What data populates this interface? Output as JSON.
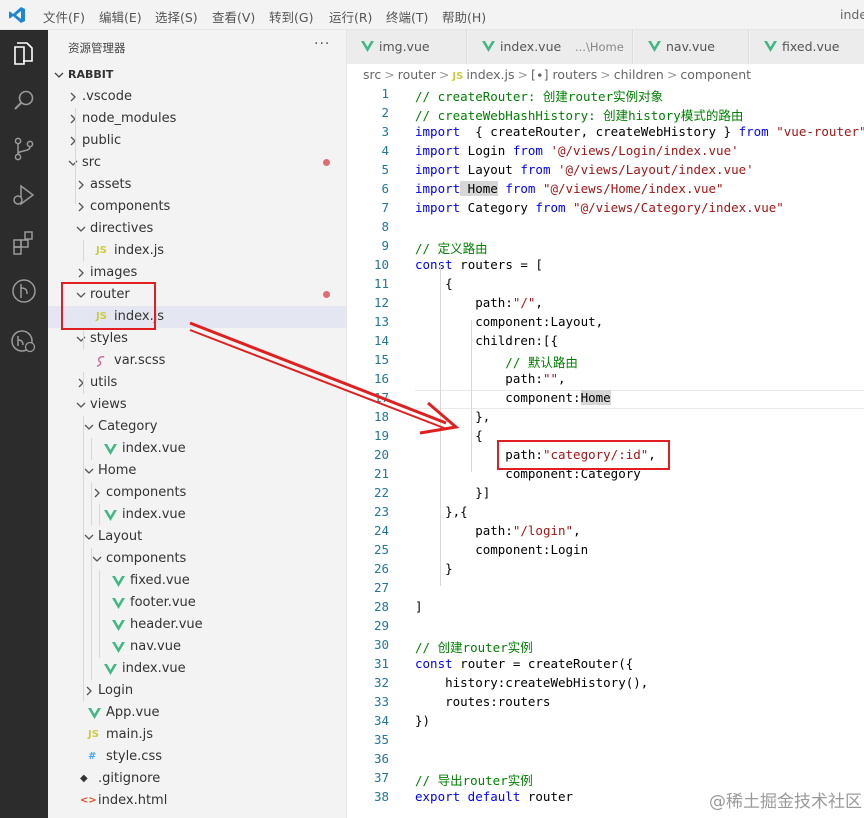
{
  "menubar": {
    "items": [
      "文件(F)",
      "编辑(E)",
      "选择(S)",
      "查看(V)",
      "转到(G)",
      "运行(R)",
      "终端(T)",
      "帮助(H)"
    ],
    "window_title": "inde"
  },
  "activity": {
    "icons": [
      "explorer-icon",
      "search-icon",
      "source-control-icon",
      "run-debug-icon",
      "extensions-icon",
      "git-graph-icon",
      "remote-icon"
    ]
  },
  "sidebar": {
    "title": "资源管理器",
    "more": "···",
    "root": "RABBIT",
    "items": [
      {
        "label": ".vscode",
        "kind": "folder",
        "open": false,
        "depth": 1
      },
      {
        "label": "node_modules",
        "kind": "folder",
        "open": false,
        "depth": 1
      },
      {
        "label": "public",
        "kind": "folder",
        "open": false,
        "depth": 1
      },
      {
        "label": "src",
        "kind": "folder",
        "open": true,
        "depth": 1,
        "modified": true
      },
      {
        "label": "assets",
        "kind": "folder",
        "open": false,
        "depth": 2
      },
      {
        "label": "components",
        "kind": "folder",
        "open": false,
        "depth": 2
      },
      {
        "label": "directives",
        "kind": "folder",
        "open": true,
        "depth": 2
      },
      {
        "label": "index.js",
        "kind": "js",
        "depth": 3
      },
      {
        "label": "images",
        "kind": "folder",
        "open": false,
        "depth": 2
      },
      {
        "label": "router",
        "kind": "folder",
        "open": true,
        "depth": 2,
        "modified": true
      },
      {
        "label": "index.js",
        "kind": "js",
        "depth": 3,
        "selected": true
      },
      {
        "label": "styles",
        "kind": "folder",
        "open": true,
        "depth": 2
      },
      {
        "label": "var.scss",
        "kind": "scss",
        "depth": 3
      },
      {
        "label": "utils",
        "kind": "folder",
        "open": false,
        "depth": 2
      },
      {
        "label": "views",
        "kind": "folder",
        "open": true,
        "depth": 2
      },
      {
        "label": "Category",
        "kind": "folder",
        "open": true,
        "depth": 3
      },
      {
        "label": "index.vue",
        "kind": "vue",
        "depth": 4
      },
      {
        "label": "Home",
        "kind": "folder",
        "open": true,
        "depth": 3
      },
      {
        "label": "components",
        "kind": "folder",
        "open": false,
        "depth": 4
      },
      {
        "label": "index.vue",
        "kind": "vue",
        "depth": 4
      },
      {
        "label": "Layout",
        "kind": "folder",
        "open": true,
        "depth": 3
      },
      {
        "label": "components",
        "kind": "folder",
        "open": true,
        "depth": 4
      },
      {
        "label": "fixed.vue",
        "kind": "vue",
        "depth": 5
      },
      {
        "label": "footer.vue",
        "kind": "vue",
        "depth": 5
      },
      {
        "label": "header.vue",
        "kind": "vue",
        "depth": 5
      },
      {
        "label": "nav.vue",
        "kind": "vue",
        "depth": 5
      },
      {
        "label": "index.vue",
        "kind": "vue",
        "depth": 4
      },
      {
        "label": "Login",
        "kind": "folder",
        "open": false,
        "depth": 3
      },
      {
        "label": "App.vue",
        "kind": "vue",
        "depth": 2
      },
      {
        "label": "main.js",
        "kind": "js",
        "depth": 2
      },
      {
        "label": "style.css",
        "kind": "css",
        "depth": 2
      },
      {
        "label": ".gitignore",
        "kind": "git",
        "depth": 1
      },
      {
        "label": "index.html",
        "kind": "html",
        "depth": 1
      }
    ]
  },
  "editor": {
    "tabs": [
      {
        "label": "img.vue",
        "detail": ""
      },
      {
        "label": "index.vue",
        "detail": "...\\Home"
      },
      {
        "label": "nav.vue",
        "detail": ""
      },
      {
        "label": "fixed.vue",
        "detail": ""
      }
    ],
    "breadcrumb": [
      "src",
      ">",
      "router",
      ">",
      "JS",
      "index.js",
      ">",
      "[∙] routers",
      ">",
      "children",
      ">",
      "component"
    ],
    "lines": [
      [
        [
          "cm",
          "// createRouter: 创建router实例对象"
        ]
      ],
      [
        [
          "cm",
          "// createWebHashHistory: 创建history模式的路由"
        ]
      ],
      [
        [
          "kw",
          "import"
        ],
        [
          "",
          "  { createRouter, createWebHistory } "
        ],
        [
          "kw",
          "from"
        ],
        [
          "st",
          " \"vue-router\""
        ]
      ],
      [
        [
          "kw",
          "import"
        ],
        [
          "",
          " Login "
        ],
        [
          "kw",
          "from"
        ],
        [
          "st",
          " '@/views/Login/index.vue'"
        ]
      ],
      [
        [
          "kw",
          "import"
        ],
        [
          "",
          " Layout "
        ],
        [
          "kw",
          "from"
        ],
        [
          "st",
          " '@/views/Layout/index.vue'"
        ]
      ],
      [
        [
          "kw",
          "import"
        ],
        [
          "hl",
          " Home"
        ],
        [
          "kw",
          " from"
        ],
        [
          "st",
          " \"@/views/Home/index.vue\""
        ]
      ],
      [
        [
          "kw",
          "import"
        ],
        [
          "",
          " Category "
        ],
        [
          "kw",
          "from"
        ],
        [
          "st",
          " \"@/views/Category/index.vue\""
        ]
      ],
      [],
      [
        [
          "cm",
          "// 定义路由"
        ]
      ],
      [
        [
          "kw",
          "const"
        ],
        [
          "",
          " routers = ["
        ]
      ],
      [
        [
          "",
          "    {"
        ]
      ],
      [
        [
          "",
          "        path:"
        ],
        [
          "st",
          "\"/\""
        ],
        [
          "",
          ","
        ]
      ],
      [
        [
          "",
          "        component:Layout,"
        ]
      ],
      [
        [
          "",
          "        children:[{"
        ]
      ],
      [
        [
          "cm",
          "            // 默认路由"
        ]
      ],
      [
        [
          "",
          "            path:"
        ],
        [
          "st",
          "\"\""
        ],
        [
          "",
          ","
        ]
      ],
      [
        [
          "",
          "            component:"
        ],
        [
          "hl",
          "Home"
        ]
      ],
      [
        [
          "",
          "        },"
        ]
      ],
      [
        [
          "",
          "        {"
        ]
      ],
      [
        [
          "",
          "            path:"
        ],
        [
          "st",
          "\"category/:id\""
        ],
        [
          "",
          ","
        ]
      ],
      [
        [
          "",
          "            component:Category"
        ]
      ],
      [
        [
          "",
          "        }]"
        ]
      ],
      [
        [
          "",
          "    },{"
        ]
      ],
      [
        [
          "",
          "        path:"
        ],
        [
          "st",
          "\"/login\""
        ],
        [
          "",
          ","
        ]
      ],
      [
        [
          "",
          "        component:Login"
        ]
      ],
      [
        [
          "",
          "    }"
        ]
      ],
      [],
      [
        [
          "",
          "]"
        ]
      ],
      [],
      [
        [
          "cm",
          "// 创建router实例"
        ]
      ],
      [
        [
          "kw",
          "const"
        ],
        [
          "",
          " router = createRouter({"
        ]
      ],
      [
        [
          "",
          "    history:createWebHistory(),"
        ]
      ],
      [
        [
          "",
          "    routes:routers"
        ]
      ],
      [
        [
          "",
          "})"
        ]
      ],
      [],
      [],
      [
        [
          "cm",
          "// 导出router实例"
        ]
      ],
      [
        [
          "kw",
          "export default"
        ],
        [
          "",
          " router"
        ]
      ]
    ]
  },
  "watermark": "@稀土掘金技术社区",
  "colors": {
    "annotation_red": "#e02020",
    "keyword": "#0000ff",
    "comment": "#008000",
    "string": "#a31515",
    "vue_green": "#41b883",
    "js_yellow": "#cbcb41"
  }
}
